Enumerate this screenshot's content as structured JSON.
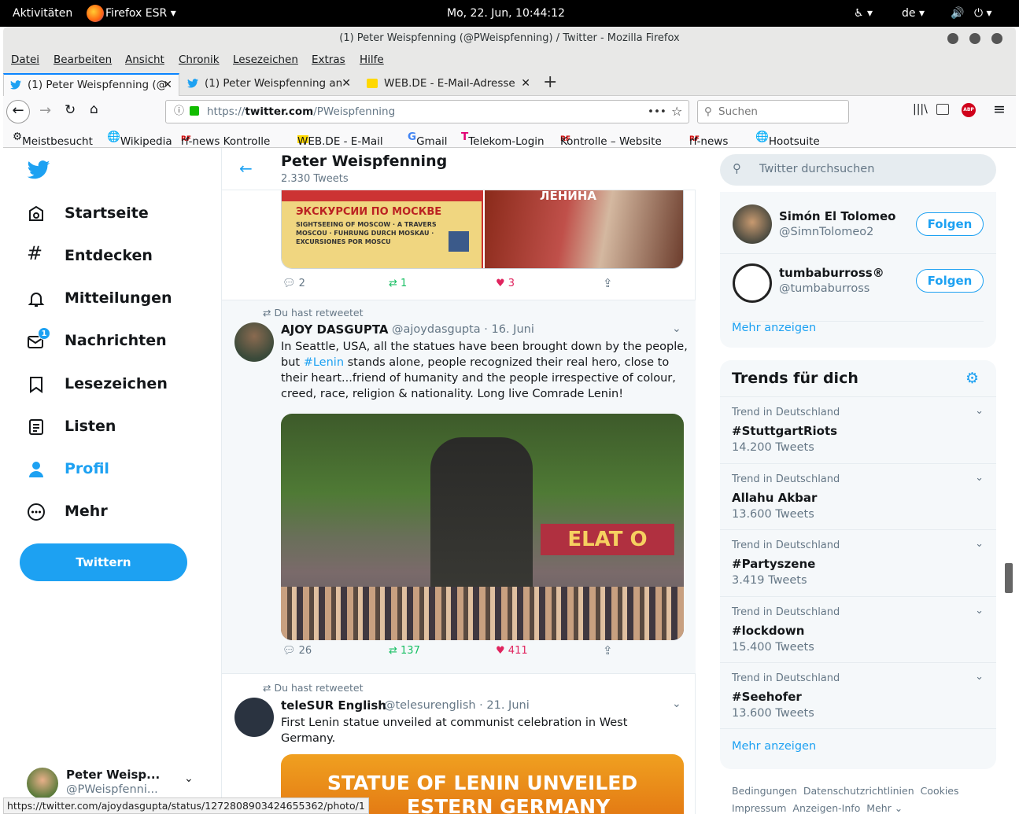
{
  "gnome": {
    "activities": "Aktivitäten",
    "app": "Firefox ESR ▾",
    "clock": "Mo, 22. Jun, 10:44:12",
    "lang": "de ▾"
  },
  "window": {
    "title": "(1) Peter Weispfenning (@PWeispfenning) / Twitter - Mozilla Firefox"
  },
  "menu": [
    "Datei",
    "Bearbeiten",
    "Ansicht",
    "Chronik",
    "Lesezeichen",
    "Extras",
    "Hilfe"
  ],
  "tabs": [
    {
      "label": "(1) Peter Weispfenning (@"
    },
    {
      "label": "(1) Peter Weispfenning an"
    },
    {
      "label": "WEB.DE - E-Mail-Adresse"
    }
  ],
  "url": {
    "prefix": "https://",
    "domain": "twitter.com",
    "path": "/PWeispfenning"
  },
  "search": {
    "placeholder": "Suchen"
  },
  "bookmarks": [
    "Meistbesucht",
    "Wikipedia",
    "rf-news Kontrolle",
    "WEB.DE - E-Mail",
    "Gmail",
    "Telekom-Login",
    "Kontrolle – Website",
    "rf-news",
    "Hootsuite"
  ],
  "sidebar": {
    "items": [
      {
        "label": "Startseite"
      },
      {
        "label": "Entdecken"
      },
      {
        "label": "Mitteilungen"
      },
      {
        "label": "Nachrichten",
        "badge": "1"
      },
      {
        "label": "Lesezeichen"
      },
      {
        "label": "Listen"
      },
      {
        "label": "Profil"
      },
      {
        "label": "Mehr"
      }
    ],
    "tweet_button": "Twittern",
    "account": {
      "name": "Peter Weisp...",
      "handle": "@PWeispfenni..."
    }
  },
  "profile_header": {
    "name": "Peter Weispfenning",
    "count": "2.330 Tweets"
  },
  "tweet0": {
    "image_text": "ЭКСКУРСИИ ПО МОСКВЕ",
    "image_sub": "SIGHTSEEING OF MOSCOW · A TRAVERS MOSCOU · FUHRUNG DURCH MOSKAU · EXCURSIONES POR MOSCU",
    "poster_text": "ЛЕНИНА",
    "replies": "2",
    "retweets": "1",
    "likes": "3"
  },
  "tweet1": {
    "retweeted": "Du hast retweetet",
    "name": "AJOY DASGUPTA",
    "handle": "@ajoydasgupta · 16. Juni",
    "text_pre": "In Seattle, USA, all the statues have been brought down by the people, but ",
    "hashtag": "#Lenin",
    "text_post": " stands alone, people recognized their real hero, close to their heart...friend of humanity and the people irrespective of colour, creed, race, religion & nationality. Long live Comrade Lenin!",
    "replies": "26",
    "retweets": "137",
    "likes": "411"
  },
  "tweet2": {
    "retweeted": "Du hast retweetet",
    "name": "teleSUR English",
    "handle": "@telesurenglish · 21. Juni",
    "text": "First Lenin statue unveiled at communist celebration in West Germany.",
    "image_line1": "STATUE OF LENIN UNVEILED",
    "image_line2": "ESTERN GERMANY"
  },
  "right": {
    "search_placeholder": "Twitter durchsuchen",
    "who": [
      {
        "name": "Simón El Tolomeo",
        "handle": "@SimnTolomeo2",
        "button": "Folgen"
      },
      {
        "name": "tumbaburross®",
        "handle": "@tumbaburross",
        "button": "Folgen"
      }
    ],
    "more": "Mehr anzeigen",
    "trends_title": "Trends für dich",
    "trends": [
      {
        "context": "Trend in Deutschland",
        "name": "#StuttgartRiots",
        "count": "14.200 Tweets"
      },
      {
        "context": "Trend in Deutschland",
        "name": "Allahu Akbar",
        "count": "13.600 Tweets"
      },
      {
        "context": "Trend in Deutschland",
        "name": "#Partyszene",
        "count": "3.419 Tweets"
      },
      {
        "context": "Trend in Deutschland",
        "name": "#lockdown",
        "count": "15.400 Tweets"
      },
      {
        "context": "Trend in Deutschland",
        "name": "#Seehofer",
        "count": "13.600 Tweets"
      }
    ],
    "trends_more": "Mehr anzeigen",
    "footer1": "Bedingungen  Datenschutzrichtlinien  Cookies",
    "footer2": "Impressum  Anzeigen-Info  Mehr ⌄"
  },
  "status_url": "https://twitter.com/ajoydasgupta/status/1272808903424655362/photo/1",
  "colors": {
    "accent": "#1da1f2",
    "like": "#e0245e",
    "retweet": "#17bf63"
  }
}
